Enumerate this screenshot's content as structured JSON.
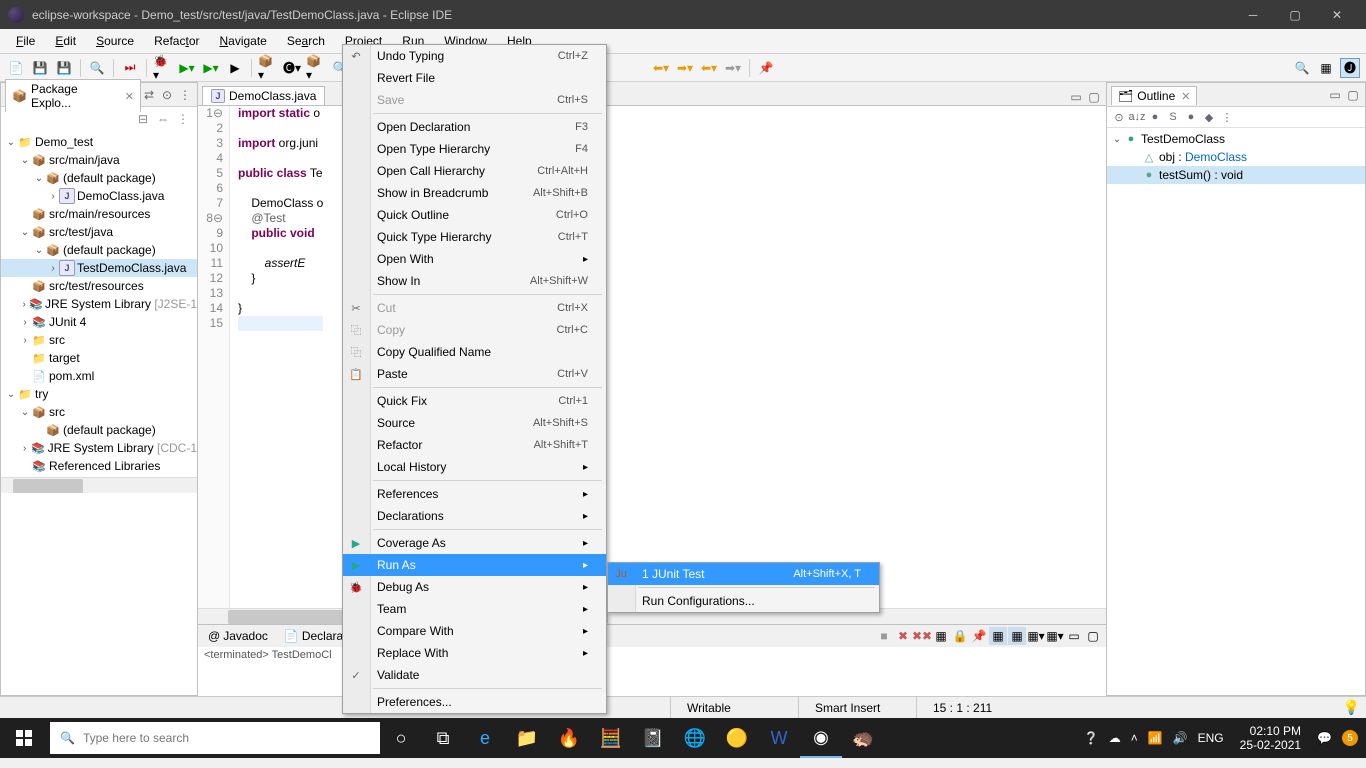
{
  "titlebar": {
    "text": "eclipse-workspace - Demo_test/src/test/java/TestDemoClass.java - Eclipse IDE"
  },
  "menubar": [
    "File",
    "Edit",
    "Source",
    "Refactor",
    "Navigate",
    "Search",
    "Project",
    "Run",
    "Window",
    "Help"
  ],
  "pkg_explorer": {
    "title": "Package Explo...",
    "tree": [
      {
        "d": 0,
        "tw": "v",
        "ic": "📁",
        "lbl": "Demo_test",
        "cls": "proj"
      },
      {
        "d": 1,
        "tw": "v",
        "ic": "📦",
        "lbl": "src/main/java"
      },
      {
        "d": 2,
        "tw": "v",
        "ic": "📦",
        "lbl": "(default package)"
      },
      {
        "d": 3,
        "tw": ">",
        "ic": "J",
        "lbl": "DemoClass.java",
        "j": true
      },
      {
        "d": 1,
        "tw": "",
        "ic": "📦",
        "lbl": "src/main/resources"
      },
      {
        "d": 1,
        "tw": "v",
        "ic": "📦",
        "lbl": "src/test/java"
      },
      {
        "d": 2,
        "tw": "v",
        "ic": "📦",
        "lbl": "(default package)"
      },
      {
        "d": 3,
        "tw": ">",
        "ic": "J",
        "lbl": "TestDemoClass.java",
        "j": true,
        "sel": true
      },
      {
        "d": 1,
        "tw": "",
        "ic": "📦",
        "lbl": "src/test/resources"
      },
      {
        "d": 1,
        "tw": ">",
        "ic": "📚",
        "lbl": "JRE System Library",
        "lib": "[J2SE-1"
      },
      {
        "d": 1,
        "tw": ">",
        "ic": "📚",
        "lbl": "JUnit 4"
      },
      {
        "d": 1,
        "tw": ">",
        "ic": "📁",
        "lbl": "src"
      },
      {
        "d": 1,
        "tw": "",
        "ic": "📁",
        "lbl": "target"
      },
      {
        "d": 1,
        "tw": "",
        "ic": "📄",
        "lbl": "pom.xml"
      },
      {
        "d": 0,
        "tw": "v",
        "ic": "📁",
        "lbl": "try",
        "cls": "proj"
      },
      {
        "d": 1,
        "tw": "v",
        "ic": "📦",
        "lbl": "src"
      },
      {
        "d": 2,
        "tw": "",
        "ic": "📦",
        "lbl": "(default package)"
      },
      {
        "d": 1,
        "tw": ">",
        "ic": "📚",
        "lbl": "JRE System Library",
        "lib": "[CDC-1"
      },
      {
        "d": 1,
        "tw": "",
        "ic": "📚",
        "lbl": "Referenced Libraries"
      }
    ]
  },
  "editor": {
    "tabs": [
      "DemoClass.java"
    ],
    "gutter": [
      "1",
      "2",
      "3",
      "4",
      "5",
      "6",
      "7",
      "8",
      "9",
      "10",
      "11",
      "12",
      "13",
      "14",
      "15"
    ],
    "code_html": [
      "<span class='kw'>import static</span> o",
      "",
      "<span class='kw'>import</span> org.juni",
      "",
      "<span class='kw'>public class</span> Te",
      "",
      "&nbsp;&nbsp;&nbsp;&nbsp;DemoClass o",
      "&nbsp;&nbsp;&nbsp;&nbsp;<span class='ann'>@Test</span>",
      "&nbsp;&nbsp;&nbsp;&nbsp;<span class='kw'>public void</span>",
      "",
      "&nbsp;&nbsp;&nbsp;&nbsp;&nbsp;&nbsp;&nbsp;&nbsp;<span class='ital'>assertE</span>",
      "&nbsp;&nbsp;&nbsp;&nbsp;}",
      "",
      "}",
      ""
    ]
  },
  "context": [
    {
      "icon": "↶",
      "lbl": "Undo Typing",
      "sc": "Ctrl+Z"
    },
    {
      "lbl": "Revert File"
    },
    {
      "lbl": "Save",
      "sc": "Ctrl+S",
      "disabled": true
    },
    {
      "sep": true
    },
    {
      "lbl": "Open Declaration",
      "sc": "F3"
    },
    {
      "lbl": "Open Type Hierarchy",
      "sc": "F4"
    },
    {
      "lbl": "Open Call Hierarchy",
      "sc": "Ctrl+Alt+H"
    },
    {
      "lbl": "Show in Breadcrumb",
      "sc": "Alt+Shift+B"
    },
    {
      "lbl": "Quick Outline",
      "sc": "Ctrl+O"
    },
    {
      "lbl": "Quick Type Hierarchy",
      "sc": "Ctrl+T"
    },
    {
      "lbl": "Open With",
      "sub": true
    },
    {
      "lbl": "Show In",
      "sc": "Alt+Shift+W",
      "sub": true
    },
    {
      "sep": true
    },
    {
      "icon": "✂",
      "lbl": "Cut",
      "sc": "Ctrl+X",
      "disabled": true
    },
    {
      "icon": "⿻",
      "lbl": "Copy",
      "sc": "Ctrl+C",
      "disabled": true
    },
    {
      "icon": "⿻",
      "lbl": "Copy Qualified Name"
    },
    {
      "icon": "📋",
      "lbl": "Paste",
      "sc": "Ctrl+V"
    },
    {
      "sep": true
    },
    {
      "lbl": "Quick Fix",
      "sc": "Ctrl+1"
    },
    {
      "lbl": "Source",
      "sc": "Alt+Shift+S",
      "sub": true
    },
    {
      "lbl": "Refactor",
      "sc": "Alt+Shift+T",
      "sub": true
    },
    {
      "lbl": "Local History",
      "sub": true
    },
    {
      "sep": true
    },
    {
      "lbl": "References",
      "sub": true
    },
    {
      "lbl": "Declarations",
      "sub": true
    },
    {
      "sep": true
    },
    {
      "icon": "▶",
      "lbl": "Coverage As",
      "sub": true,
      "iconcolor": "#2a8"
    },
    {
      "icon": "▶",
      "lbl": "Run As",
      "sub": true,
      "hl": true,
      "iconcolor": "#2a8"
    },
    {
      "icon": "🐞",
      "lbl": "Debug As",
      "sub": true
    },
    {
      "lbl": "Team",
      "sub": true
    },
    {
      "lbl": "Compare With",
      "sub": true
    },
    {
      "lbl": "Replace With",
      "sub": true
    },
    {
      "icon": "✓",
      "lbl": "Validate"
    },
    {
      "sep": true
    },
    {
      "lbl": "Preferences..."
    }
  ],
  "submenu": [
    {
      "icon": "Ju",
      "lbl": "1 JUnit Test",
      "sc": "Alt+Shift+X, T",
      "hl": true,
      "iconcolor": "#b52"
    },
    {
      "sep": true
    },
    {
      "lbl": "Run Configurations..."
    }
  ],
  "outline": {
    "title": "Outline",
    "items": [
      {
        "d": 0,
        "tw": "v",
        "ic": "●",
        "lbl": "TestDemoClass",
        "color": "#2a8"
      },
      {
        "d": 1,
        "tw": "",
        "ic": "△",
        "lbl": "obj : ",
        "tail": "DemoClass",
        "tailcolor": "#0066cc"
      },
      {
        "d": 1,
        "tw": "",
        "ic": "●",
        "lbl": "testSum() : void",
        "sel": true
      }
    ]
  },
  "bottom": {
    "tabs": [
      "Javadoc",
      "Declarati"
    ],
    "console": "<terminated> TestDemoCl"
  },
  "status": {
    "writable": "Writable",
    "insert": "Smart Insert",
    "pos": "15 : 1 : 211"
  },
  "taskbar": {
    "search_placeholder": "Type here to search",
    "time": "02:10 PM",
    "date": "25-02-2021",
    "lang": "ENG"
  }
}
